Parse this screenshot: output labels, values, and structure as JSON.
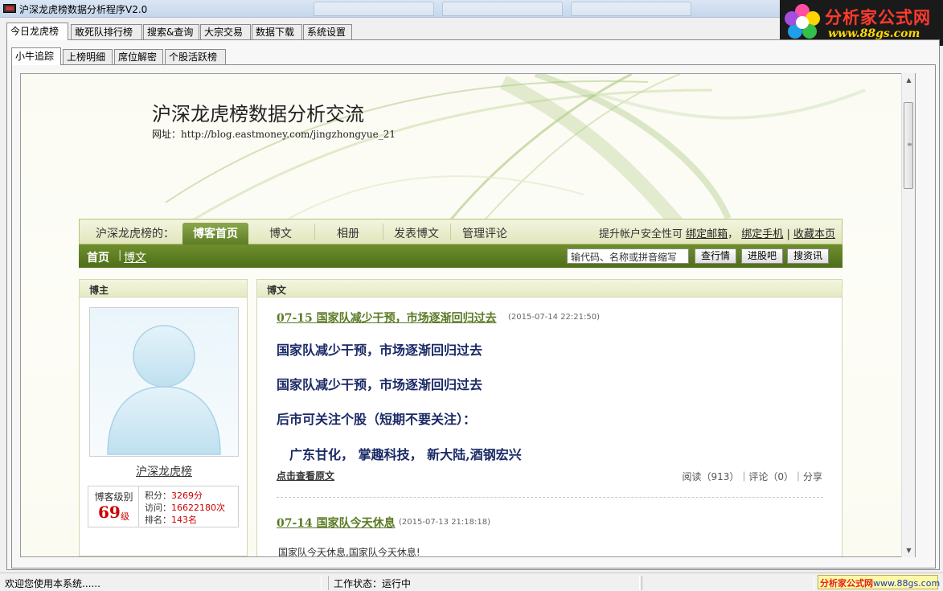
{
  "window": {
    "title": "沪深龙虎榜数据分析程序V2.0"
  },
  "logo": {
    "name": "分析家公式网",
    "url": "www.88gs.com"
  },
  "main_tabs": [
    {
      "label": "今日龙虎榜",
      "active": true
    },
    {
      "label": "敢死队排行榜",
      "active": false
    },
    {
      "label": "搜索&查询",
      "active": false
    },
    {
      "label": "大宗交易",
      "active": false
    },
    {
      "label": "数据下载",
      "active": false
    },
    {
      "label": "系统设置",
      "active": false
    }
  ],
  "sub_tabs": [
    {
      "label": "小牛追踪",
      "active": true
    },
    {
      "label": "上榜明细",
      "active": false
    },
    {
      "label": "席位解密",
      "active": false
    },
    {
      "label": "个股活跃榜",
      "active": false
    }
  ],
  "blog": {
    "title": "沪深龙虎榜数据分析交流",
    "url_line": "网址：http://blog.eastmoney.com/jingzhongyue_21"
  },
  "nav": {
    "prefix": "沪深龙虎榜的：",
    "items": [
      "博客首页",
      "博文",
      "相册",
      "发表博文",
      "管理评论"
    ],
    "right_text": "提升帐户安全性可",
    "right_links": [
      "绑定邮箱",
      "绑定手机",
      "收藏本页"
    ],
    "right_sep1": "，",
    "right_sep2": "|"
  },
  "subnav": {
    "home": "首页",
    "sep": "|",
    "post": "博文",
    "search_placeholder": "输代码、名称或拼音缩写",
    "buttons": [
      "查行情",
      "进股吧",
      "搜资讯"
    ]
  },
  "sidebar": {
    "header": "博主",
    "name": "沪深龙虎榜",
    "level_label": "博客级别",
    "level": "69",
    "level_unit": "级",
    "stats": [
      {
        "label": "积分：",
        "value": "3269分"
      },
      {
        "label": "访问：",
        "value": "16622180次"
      },
      {
        "label": "排名：",
        "value": "143名"
      }
    ]
  },
  "posts_panel": {
    "header": "博文",
    "post1": {
      "title": "07-15 国家队减少干预，市场逐渐回归过去",
      "time": "(2015-07-14 22:21:50)",
      "lines": [
        "国家队减少干预，市场逐渐回归过去",
        "国家队减少干预，市场逐渐回归过去",
        "后市可关注个股（短期不要关注）：",
        "广东甘化，  掌趣科技，  新大陆,酒钢宏兴"
      ],
      "read_more": "点击查看原文",
      "meta": "阅读（913）｜评论（0）｜分享"
    },
    "post2": {
      "title": "07-14 国家队今天休息",
      "time": "(2015-07-13 21:18:18)",
      "body": "国家队今天休息,国家队今天休息!"
    }
  },
  "status": {
    "left": "欢迎您使用本系统......",
    "work": "工作状态：运行中",
    "logo_red": "分析家公式网",
    "logo_blue": "www.88gs.com"
  }
}
